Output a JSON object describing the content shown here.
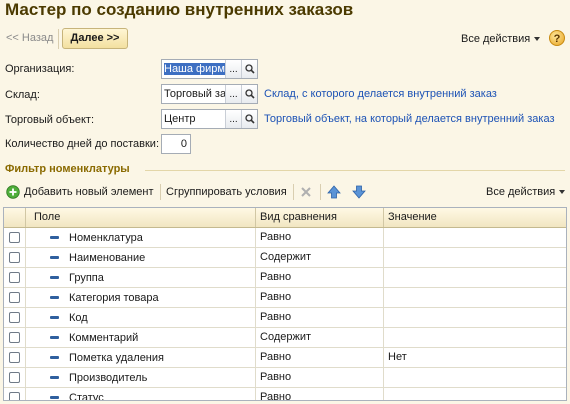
{
  "window": {
    "title": "Мастер по созданию внутренних заказов"
  },
  "nav": {
    "back_label": "<< Назад",
    "next_label": "Далее >>",
    "all_actions_label": "Все действия",
    "help_glyph": "?"
  },
  "form": {
    "organization": {
      "label": "Организация:",
      "value": "Наша фирма"
    },
    "warehouse": {
      "label": "Склад:",
      "value": "Торговый зал",
      "hint": "Склад, с которого делается внутренний заказ"
    },
    "trade_object": {
      "label": "Торговый объект:",
      "value": "Центр",
      "hint": "Торговый объект, на который делается внутренний заказ"
    },
    "delivery_days": {
      "label": "Количество дней до поставки:",
      "value": "0"
    }
  },
  "filter": {
    "title": "Фильтр номенклатуры",
    "toolbar": {
      "add_label": "Добавить новый элемент",
      "group_label": "Сгруппировать условия",
      "all_actions_label": "Все действия"
    },
    "columns": [
      "Поле",
      "Вид сравнения",
      "Значение"
    ],
    "rows": [
      {
        "field": "Номенклатура",
        "comparison": "Равно",
        "value": ""
      },
      {
        "field": "Наименование",
        "comparison": "Содержит",
        "value": ""
      },
      {
        "field": "Группа",
        "comparison": "Равно",
        "value": ""
      },
      {
        "field": "Категория товара",
        "comparison": "Равно",
        "value": ""
      },
      {
        "field": "Код",
        "comparison": "Равно",
        "value": ""
      },
      {
        "field": "Комментарий",
        "comparison": "Содержит",
        "value": ""
      },
      {
        "field": "Пометка удаления",
        "comparison": "Равно",
        "value": "Нет"
      },
      {
        "field": "Производитель",
        "comparison": "Равно",
        "value": ""
      },
      {
        "field": "Статус",
        "comparison": "Равно",
        "value": ""
      }
    ]
  },
  "icons": {
    "search": "search-icon",
    "select": "ellipsis-icon",
    "add": "add-icon",
    "delete": "delete-icon",
    "up": "arrow-up-icon",
    "down": "arrow-down-icon"
  },
  "colors": {
    "background": "#fbf6e6",
    "title": "#4b3a00",
    "link": "#1c52b5",
    "section": "#8a6a00"
  }
}
